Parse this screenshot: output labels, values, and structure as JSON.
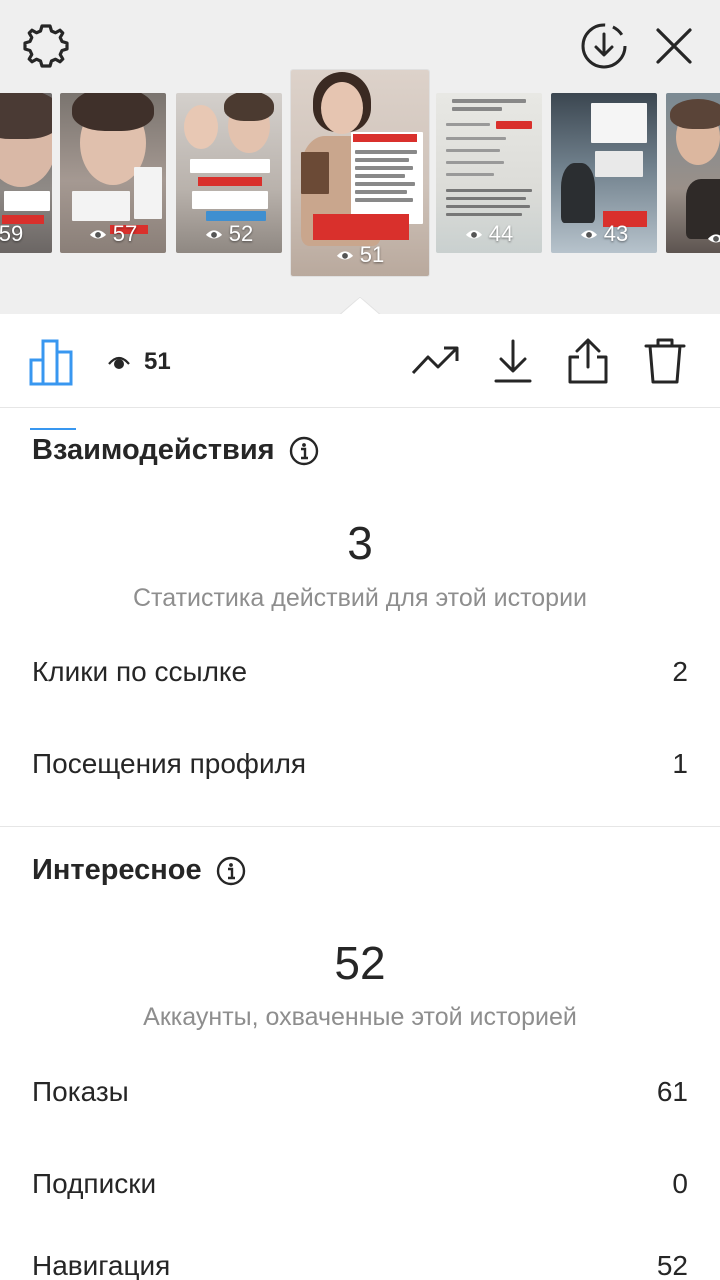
{
  "top_bar": {
    "icons": [
      "gear-icon",
      "download-circle-icon",
      "close-icon"
    ]
  },
  "stories": [
    {
      "views": "59",
      "tone": "#8f8a86"
    },
    {
      "views": "57",
      "tone": "#a59992"
    },
    {
      "views": "52",
      "tone": "#b9b2ac"
    },
    {
      "views": "51",
      "tone": "#cfc3ba",
      "selected": true
    },
    {
      "views": "44",
      "tone": "#dcdcd8"
    },
    {
      "views": "43",
      "tone": "#b7c3cc"
    },
    {
      "views": "",
      "tone": "#9a9089"
    }
  ],
  "selected_story": {
    "views": "51"
  },
  "toolbar": {
    "icons": [
      "bar-chart-icon",
      "eye-icon",
      "trending-icon",
      "download-icon",
      "share-icon",
      "trash-icon"
    ]
  },
  "interactions": {
    "title": "Взаимодействия",
    "total": "3",
    "caption": "Статистика действий для этой истории",
    "rows": [
      {
        "label": "Клики по ссылке",
        "value": "2"
      },
      {
        "label": "Посещения профиля",
        "value": "1"
      }
    ]
  },
  "discovery": {
    "title": "Интересное",
    "total": "52",
    "caption": "Аккаунты, охваченные этой историей",
    "rows": [
      {
        "label": "Показы",
        "value": "61"
      },
      {
        "label": "Подписки",
        "value": "0"
      },
      {
        "label": "Навигация",
        "value": "52"
      }
    ]
  },
  "colors": {
    "accent": "#3897f0",
    "text": "#262626",
    "muted": "#8e8e8e",
    "top_bg": "#efefef"
  }
}
